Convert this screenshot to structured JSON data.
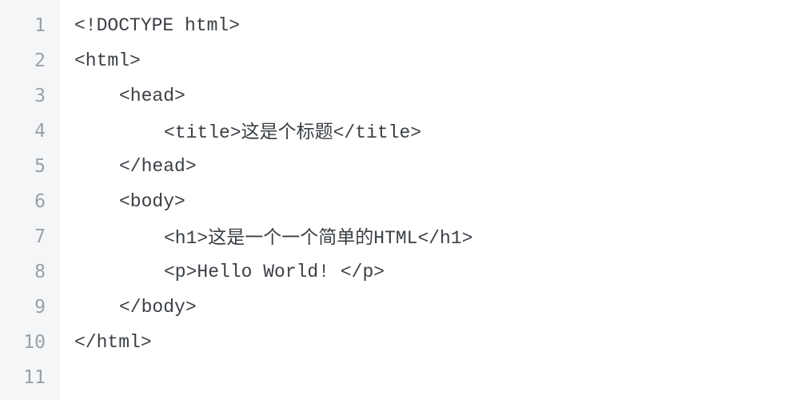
{
  "gutter": {
    "lines": [
      "1",
      "2",
      "3",
      "4",
      "5",
      "6",
      "7",
      "8",
      "9",
      "10",
      "11"
    ]
  },
  "code": {
    "line1": {
      "text": "<!DOCTYPE html>",
      "indent": 0
    },
    "line2": {
      "text": "<html>",
      "indent": 0
    },
    "line3": {
      "text": "<head>",
      "indent": 1
    },
    "line4": {
      "prefix": "<title>",
      "cjk": "这是个标题",
      "suffix": "</title>",
      "indent": 2
    },
    "line5": {
      "text": "</head>",
      "indent": 1
    },
    "line6": {
      "text": "<body>",
      "indent": 1
    },
    "line7": {
      "prefix": "<h1>",
      "cjk": "这是一个一个简单的",
      "mid": "HTML",
      "suffix": "</h1>",
      "indent": 2
    },
    "line8": {
      "text": "<p>Hello World! </p>",
      "indent": 2
    },
    "line9": {
      "text": "</body>",
      "indent": 1
    },
    "line10": {
      "text": "</html>",
      "indent": 0
    },
    "line11": {
      "text": "",
      "indent": 0
    }
  }
}
